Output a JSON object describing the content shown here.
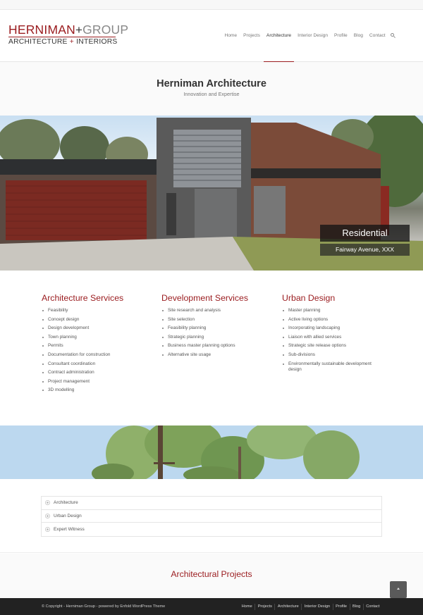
{
  "logo": {
    "brand_a": "HERNIMAN",
    "plus": "+",
    "brand_b": "GROUP",
    "sub_a": "ARCHITECTURE",
    "sub_plus": "+",
    "sub_b": "INTERIORS"
  },
  "nav": {
    "items": [
      "Home",
      "Projects",
      "Architecture",
      "Interior Design",
      "Profile",
      "Blog",
      "Contact"
    ],
    "active": "Architecture",
    "search_icon": "search-icon"
  },
  "title": {
    "heading": "Herniman Architecture",
    "subtitle": "Innovation and Expertise"
  },
  "hero": {
    "caption_title": "Residential",
    "caption_sub": "Fairway Avenue, XXX"
  },
  "services": {
    "columns": [
      {
        "heading": "Architecture Services",
        "items": [
          "Feasibility",
          "Concept design",
          "Design development",
          "Town planning",
          "Permits",
          "Documentation for construction",
          "Consultant coordination",
          "Contract administration",
          "Project management",
          "3D modelling"
        ]
      },
      {
        "heading": "Development Services",
        "items": [
          "Site research and analysis",
          "Site selection",
          "Feasibility planning",
          "Strategic planning",
          "Business master planning options",
          "Alternative site usage"
        ]
      },
      {
        "heading": "Urban Design",
        "items": [
          "Master planning",
          "Active living options",
          "Incorporating landscaping",
          "Liaison with allied services",
          "Strategic site release options",
          "Sub-divisions",
          "Environmentally sustainable development design"
        ]
      }
    ]
  },
  "accordion": {
    "items": [
      "Architecture",
      "Urban Design",
      "Expert Witness"
    ]
  },
  "projects": {
    "heading": "Architectural Projects"
  },
  "footer": {
    "copyright": "© Copyright - Herniman Group - powered by Enfold WordPress Theme",
    "nav": [
      "Home",
      "Projects",
      "Architecture",
      "Interior Design",
      "Profile",
      "Blog",
      "Contact"
    ]
  },
  "colors": {
    "accent": "#9a1b1e",
    "footer_bg": "#222222",
    "text": "#555555"
  }
}
